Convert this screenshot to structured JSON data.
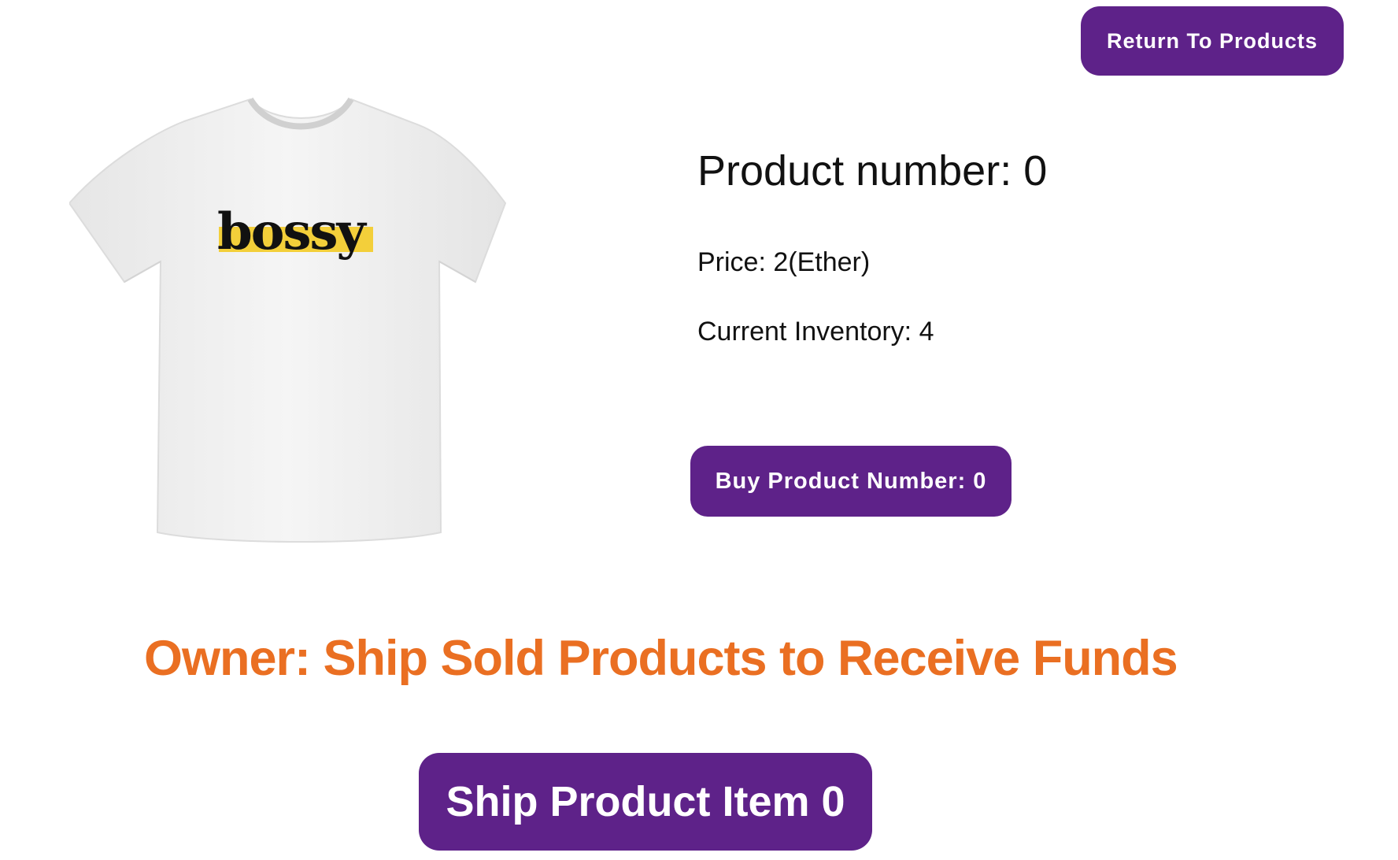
{
  "header": {
    "return_label": "Return To Products"
  },
  "product": {
    "image_name": "tshirt-image",
    "shirt_text": "bossy",
    "title": "Product number: 0",
    "price": "Price: 2(Ether)",
    "inventory": "Current Inventory: 4",
    "buy_label": "Buy Product Number: 0"
  },
  "owner": {
    "heading": "Owner: Ship Sold Products to Receive Funds",
    "ship_label": "Ship Product Item 0"
  },
  "colors": {
    "button_bg": "#5e2289",
    "heading": "#ea6f22",
    "highlight": "#f3cf3a"
  }
}
